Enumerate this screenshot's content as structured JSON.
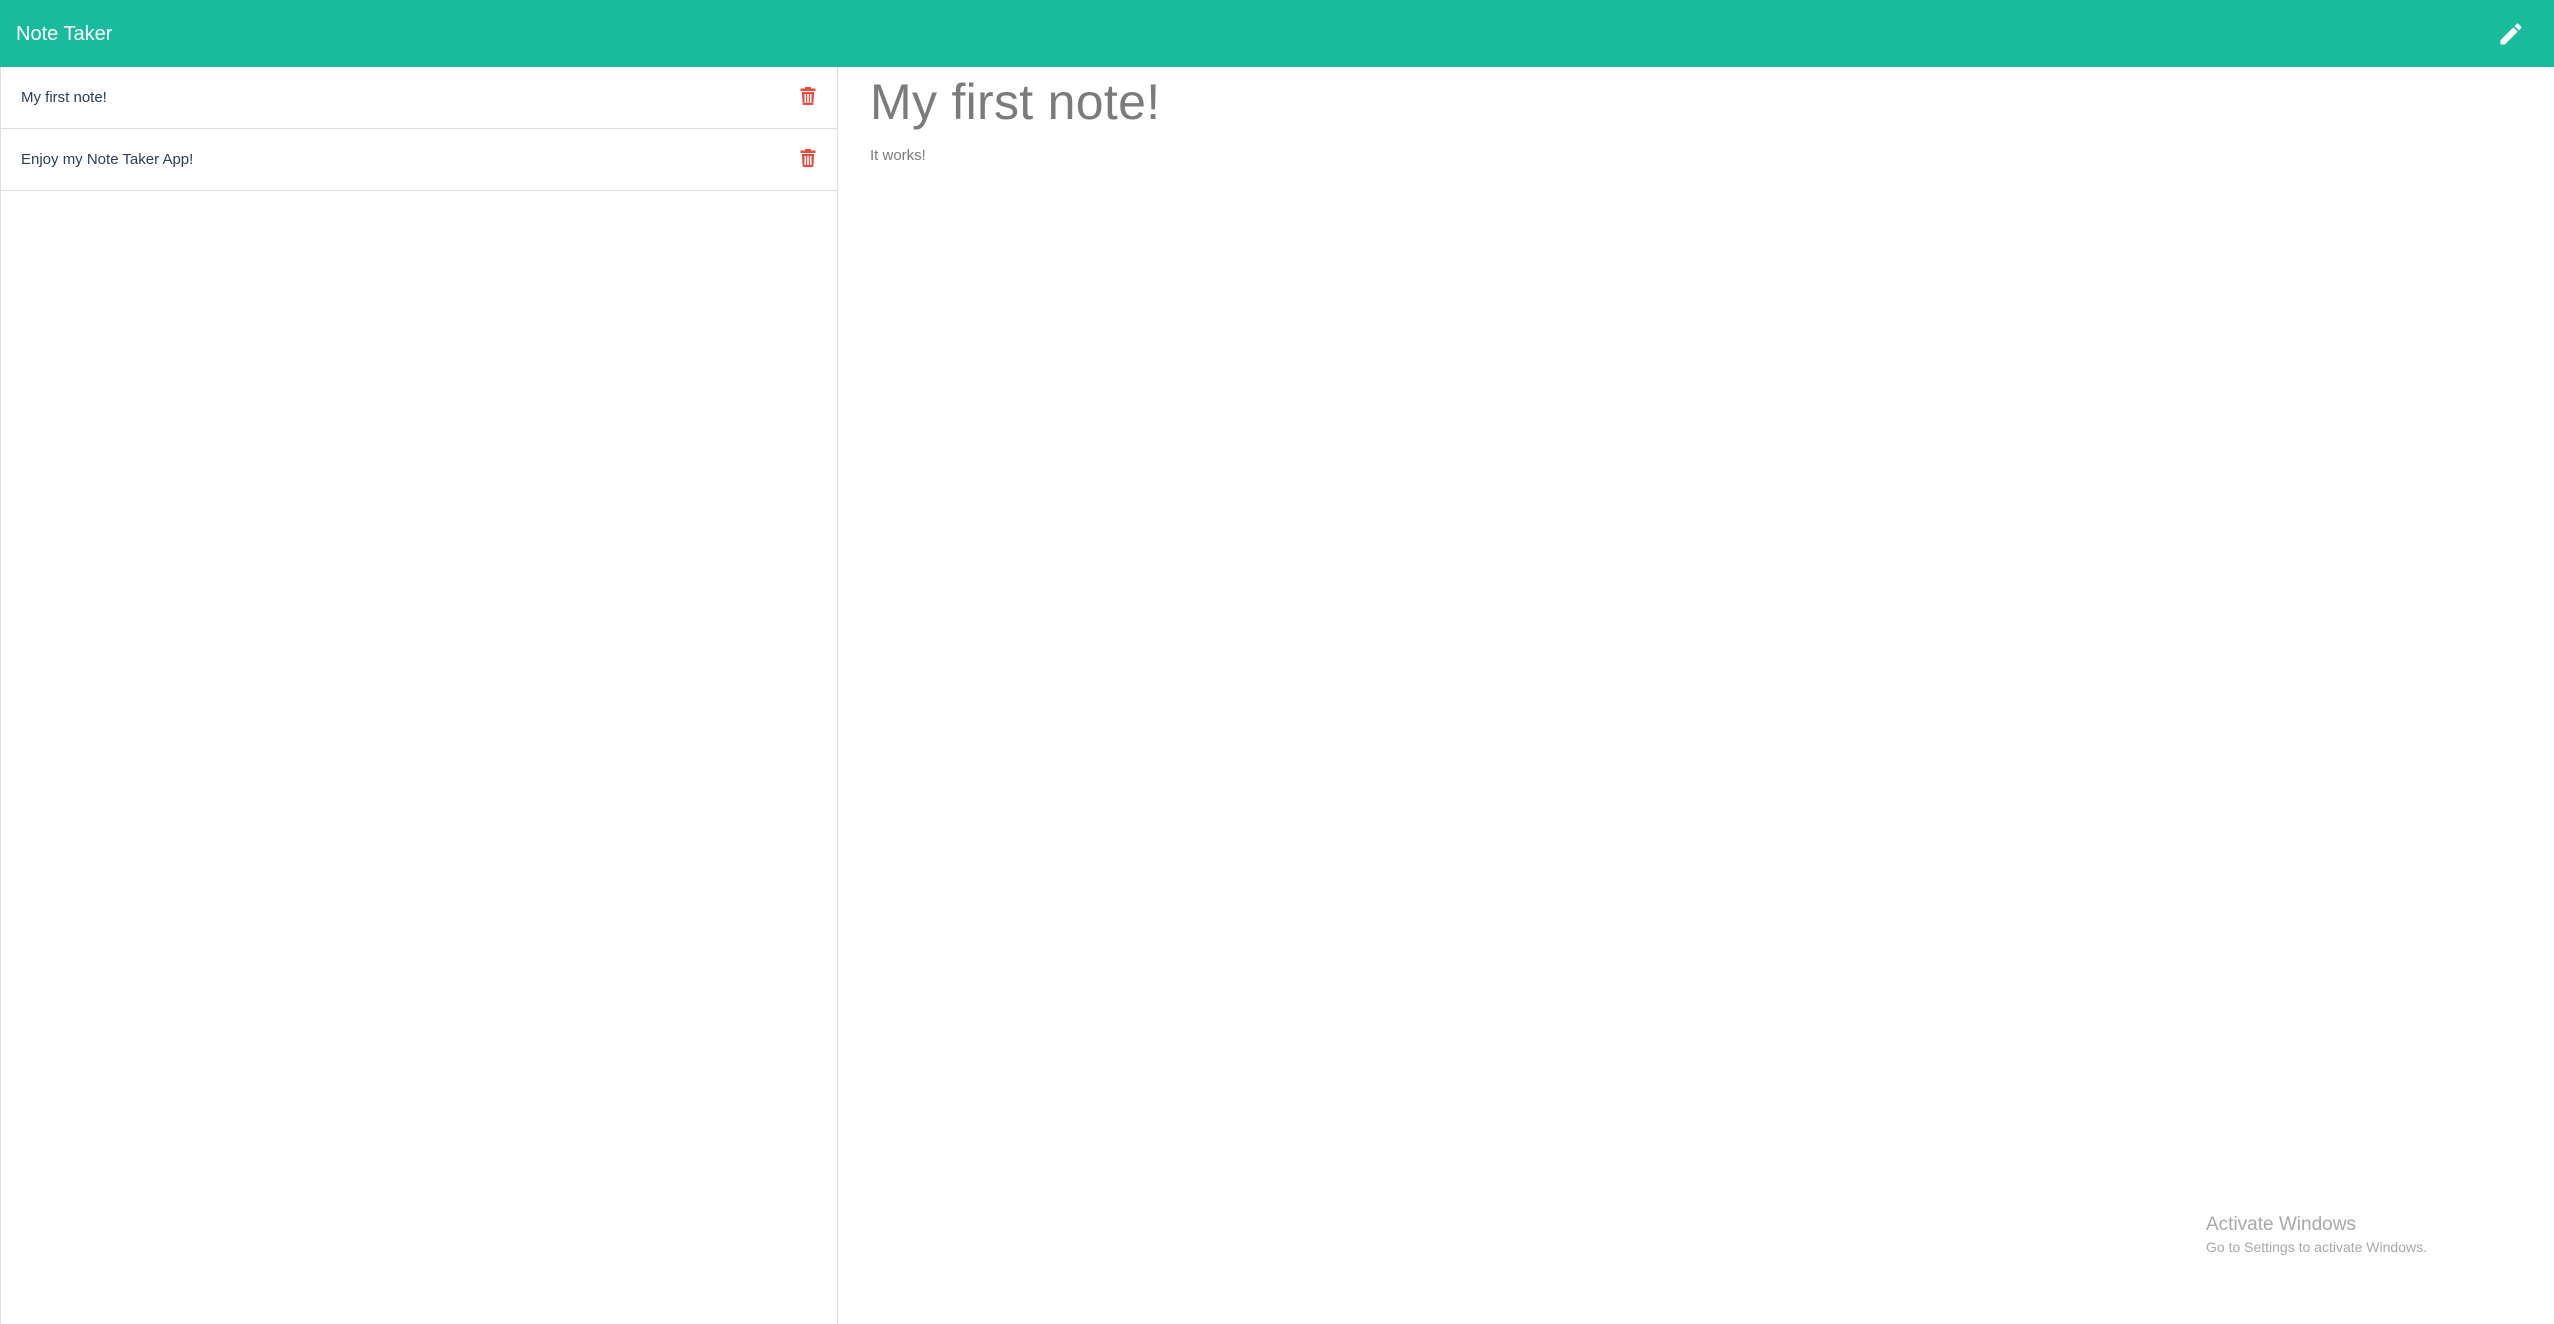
{
  "navbar": {
    "brand": "Note Taker",
    "new_note_icon": "pencil-icon"
  },
  "notes": [
    {
      "title": "My first note!",
      "delete_icon": "trash-icon"
    },
    {
      "title": "Enjoy my Note Taker App!",
      "delete_icon": "trash-icon"
    }
  ],
  "active_note": {
    "title": "My first note!",
    "text": "It works!"
  },
  "watermark": {
    "title": "Activate Windows",
    "subtitle": "Go to Settings to activate Windows."
  },
  "colors": {
    "navbar_bg": "#18bc9c",
    "delete_icon": "#e74c3c",
    "heading_text": "#7b7b7b"
  }
}
